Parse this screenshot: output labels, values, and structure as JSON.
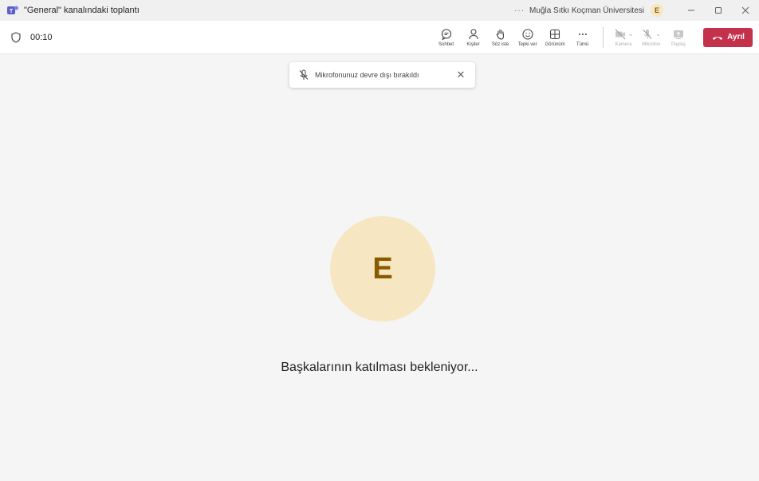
{
  "window": {
    "title": "\"General\" kanalındaki toplantı",
    "more": "···",
    "organization": "Muğla Sıtkı Koçman Üniversitesi",
    "user_initial": "E"
  },
  "toolbar": {
    "timer": "00:10",
    "buttons": [
      {
        "label": "Sohbet",
        "icon": "chat-icon"
      },
      {
        "label": "Kişiler",
        "icon": "people-icon"
      },
      {
        "label": "Söz iste",
        "icon": "raise-hand-icon"
      },
      {
        "label": "Tepki ver",
        "icon": "smiley-icon"
      },
      {
        "label": "Görünüm",
        "icon": "grid-view-icon"
      },
      {
        "label": "Tümü",
        "icon": "more-icon"
      }
    ],
    "media": [
      {
        "label": "Kamera",
        "icon": "camera-icon"
      },
      {
        "label": "Mikrofon",
        "icon": "microphone-icon"
      },
      {
        "label": "Paylaş",
        "icon": "share-screen-icon"
      }
    ],
    "leave_label": "Ayrıl"
  },
  "toast": {
    "text": "Mikrofonunuz devre dışı bırakıldı",
    "close": "✕"
  },
  "stage": {
    "avatar_initial": "E",
    "waiting_text": "Başkalarının katılması bekleniyor..."
  },
  "colors": {
    "leave": "#c4314b",
    "avatar_bg": "#f6e6c1",
    "avatar_fg": "#8a5a00"
  }
}
